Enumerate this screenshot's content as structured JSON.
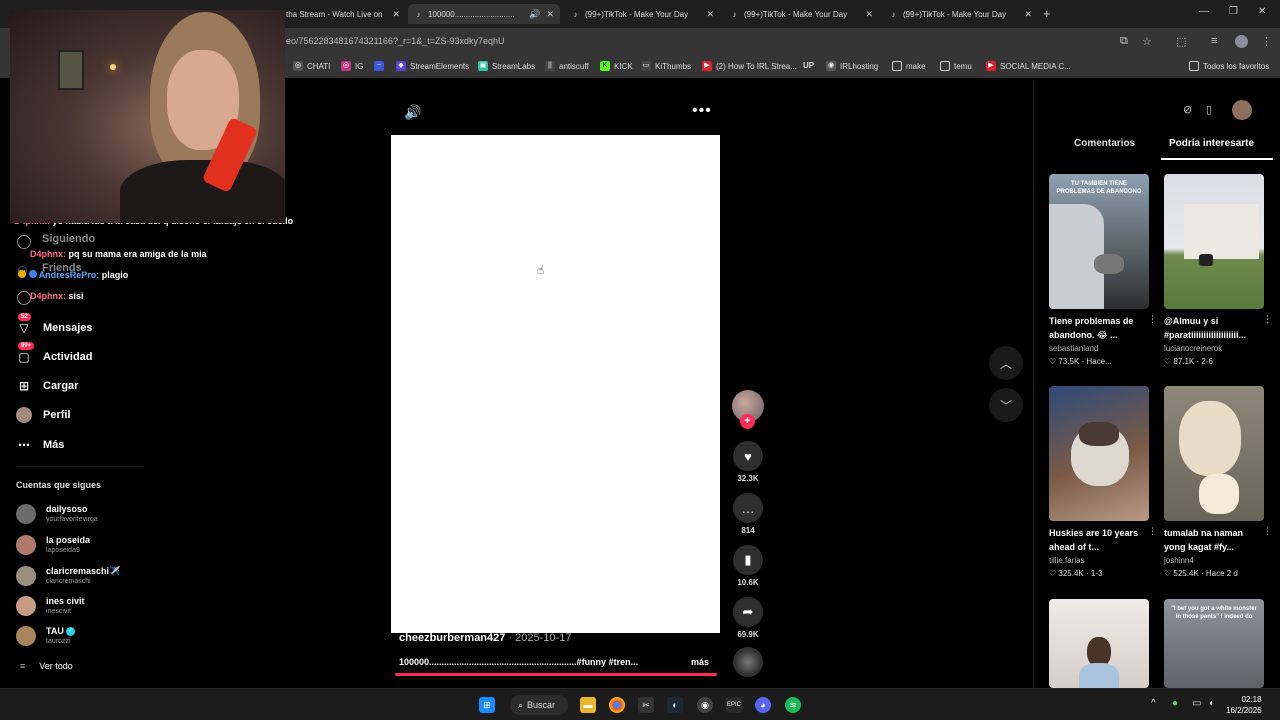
{
  "browser": {
    "tabs": [
      {
        "label": "tha Stream - Watch Live on",
        "active": false
      },
      {
        "label": "100000...........................",
        "active": true
      },
      {
        "label": "(99+)TikTok - Make Your Day",
        "active": false
      },
      {
        "label": "(99+)TikTok - Make Your Day",
        "active": false
      },
      {
        "label": "(99+)TikTok - Make Your Day",
        "active": false
      }
    ],
    "url": "eo/7562283481674321166?_r=1&_t=ZS-93xdky7eqhU",
    "bookmarks": [
      "CHATI",
      "IG",
      "",
      "StreamElements",
      "StreamLabs",
      "antiscuff",
      "KICK",
      "KiThumbs",
      "(2) How To IRL Strea...",
      "UP",
      "IRLhosting",
      "make",
      "temu",
      "SOCIAL MEDIA C..."
    ],
    "bookmarks_all": "Todos los favoritos"
  },
  "sidebar": {
    "nav": [
      {
        "label": "Siguiendo",
        "icon": "following-icon"
      },
      {
        "label": "Friends",
        "icon": "friends-icon"
      },
      {
        "label": "",
        "icon": "live-icon"
      },
      {
        "label": "Mensajes",
        "icon": "messages-icon",
        "badge": "52"
      },
      {
        "label": "Actividad",
        "icon": "activity-icon",
        "badge": "99+"
      },
      {
        "label": "Cargar",
        "icon": "upload-icon"
      },
      {
        "label": "Perfil",
        "icon": "profile-icon"
      },
      {
        "label": "Más",
        "icon": "more-icon"
      }
    ],
    "following_title": "Cuentas que sigues",
    "following": [
      {
        "name": "dailysoso",
        "handle": "yourfavoritevirga",
        "color": "#6b6b6b"
      },
      {
        "name": "la poseida",
        "handle": "laposeida9",
        "color": "#b07a6b"
      },
      {
        "name": "claricremaschi✈️",
        "handle": "claricremaschi",
        "color": "#9a8f7f"
      },
      {
        "name": "ines civit",
        "handle": "inescivit",
        "color": "#c99a84"
      },
      {
        "name": "TAU",
        "handle": "taurozzi",
        "color": "#a8845d",
        "verified": true
      }
    ],
    "see_all": "Ver todo"
  },
  "chat": [
    {
      "user": "D4phnx:",
      "text": "yo habia ido a la casa del q diseño el tatuaje en el cuello"
    },
    {
      "user": "D4phnx:",
      "text": "pq su mama era amiga de la mia"
    },
    {
      "user": "AndresRePro:",
      "text": "plagio"
    },
    {
      "user": "D4phnx:",
      "text": "sisi"
    }
  ],
  "video": {
    "author": "cheezburberman427",
    "date": " · 2025-10-17",
    "caption": "100000...........................................................#funny #tren...",
    "more": "más",
    "progress": 1.0,
    "likes": "32.3K",
    "comments": "814",
    "saves": "10.6K",
    "shares": "69.9K"
  },
  "panel": {
    "tabs": [
      "Comentarios",
      "Podría interesarte"
    ],
    "active_tab": 1,
    "tiles": [
      {
        "title": "Tiene problemas de abandono. 😂 ...",
        "author": "sebastianland",
        "stats": "♡ 73.5K · Hace...",
        "thumb": "TU TAMBIEN TIENE PROBLEMAS DE ABANDONO"
      },
      {
        "title": "@Almuu y si #paratiiiiiiiiiiiiiiiiiii...",
        "author": "lucianocreinerok",
        "stats": "♡ 87.1K · 2-6",
        "thumb": ""
      },
      {
        "title": "Huskies are 10 years ahead of t...",
        "author": "tillie.farias",
        "stats": "♡ 325.4K · 1-3",
        "thumb": ""
      },
      {
        "title": "tumalab na naman yong kagat #fy...",
        "author": "joshinn4",
        "stats": "♡ 525.4K · Hace 2 d",
        "thumb": ""
      },
      {
        "title": "",
        "author": "",
        "stats": "",
        "thumb": ""
      },
      {
        "title": "",
        "author": "",
        "stats": "",
        "thumb": "\"I bet you got a white monster in those pants\" I indeed do"
      }
    ]
  },
  "taskbar": {
    "search": "Buscar",
    "time": "02:18",
    "date": "16/2/2026"
  }
}
